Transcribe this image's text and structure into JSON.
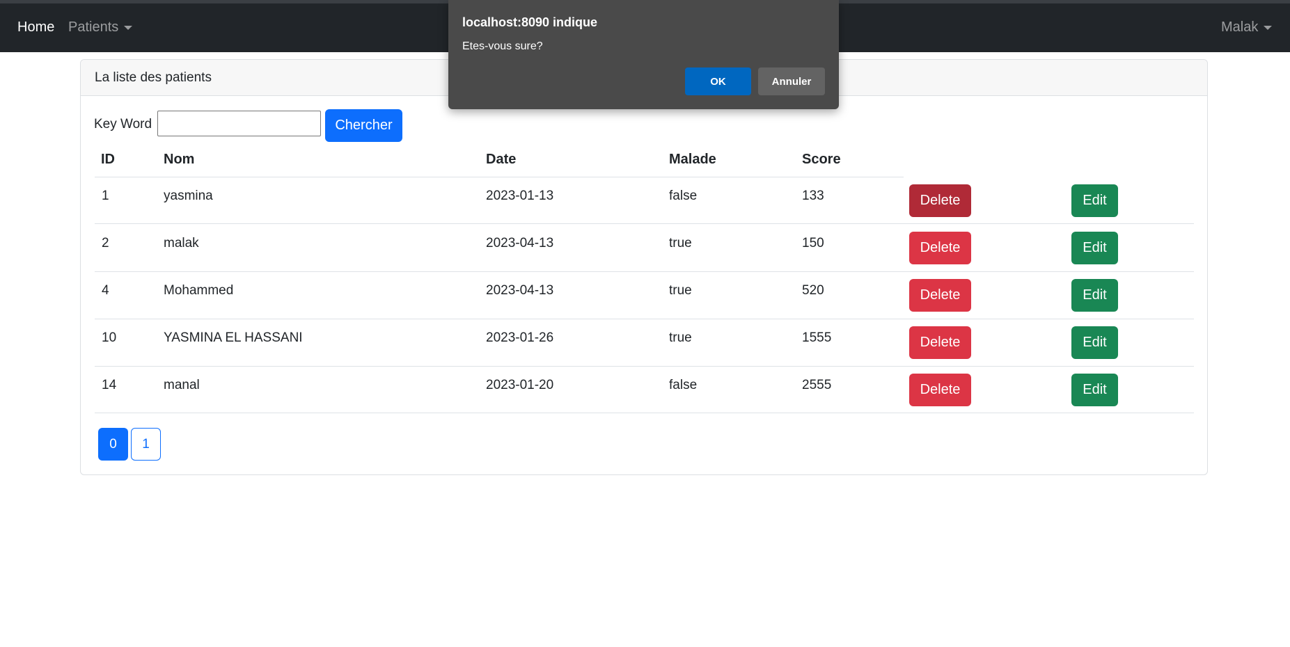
{
  "navbar": {
    "home_label": "Home",
    "patients_label": "Patients",
    "user_label": "Malak"
  },
  "card": {
    "title": "La liste des patients"
  },
  "search": {
    "label": "Key Word",
    "value": "",
    "button_label": "Chercher"
  },
  "table": {
    "headers": [
      "ID",
      "Nom",
      "Date",
      "Malade",
      "Score"
    ],
    "delete_label": "Delete",
    "edit_label": "Edit",
    "rows": [
      {
        "id": "1",
        "nom": "yasmina",
        "date": "2023-01-13",
        "malade": "false",
        "score": "133"
      },
      {
        "id": "2",
        "nom": "malak",
        "date": "2023-04-13",
        "malade": "true",
        "score": "150"
      },
      {
        "id": "4",
        "nom": "Mohammed",
        "date": "2023-04-13",
        "malade": "true",
        "score": "520"
      },
      {
        "id": "10",
        "nom": "YASMINA EL HASSANI",
        "date": "2023-01-26",
        "malade": "true",
        "score": "1555"
      },
      {
        "id": "14",
        "nom": "manal",
        "date": "2023-01-20",
        "malade": "false",
        "score": "2555"
      }
    ]
  },
  "pagination": {
    "pages": [
      "0",
      "1"
    ],
    "active_page": "0"
  },
  "dialog": {
    "title": "localhost:8090 indique",
    "message": "Etes-vous sure?",
    "ok_label": "OK",
    "cancel_label": "Annuler"
  },
  "colors": {
    "navbar_bg": "#212529",
    "primary": "#0d6efd",
    "danger": "#dc3545",
    "success": "#198754",
    "dialog_bg": "#4a4a4a"
  }
}
